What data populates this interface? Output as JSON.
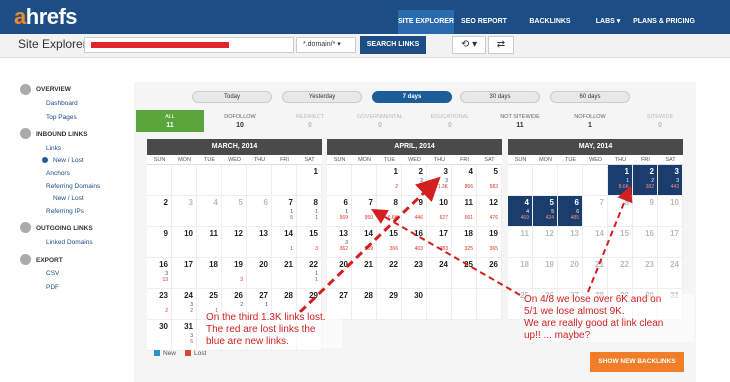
{
  "header": {
    "logo_a": "a",
    "logo_rest": "hrefs",
    "nav": [
      {
        "label": "SITE EXPLORER",
        "active": true
      },
      {
        "label": "SEO REPORT",
        "active": false
      },
      {
        "label": "BACKLINKS REPORT",
        "active": false
      },
      {
        "label": "LABS",
        "active": false
      },
      {
        "label": "PLANS & PRICING",
        "active": false
      }
    ]
  },
  "search": {
    "label": "Site Explorer:",
    "mode_value": "*.domain/*",
    "button_label": "SEARCH LINKS"
  },
  "sidebar": {
    "overview": "OVERVIEW",
    "dashboard": "Dashboard",
    "top_pages": "Top Pages",
    "inbound": "INBOUND LINKS",
    "links": "Links",
    "new_lost": "New / Lost",
    "anchors": "Anchors",
    "ref_domains": "Referring Domains",
    "ref_new_lost": "New / Lost",
    "ref_ips": "Referring IPs",
    "outgoing": "OUTGOING LINKS",
    "linked_domains": "Linked Domains",
    "export": "EXPORT",
    "csv": "CSV",
    "pdf": "PDF"
  },
  "periods": [
    "Today",
    "Yesterday",
    "7 days",
    "30 days",
    "60 days"
  ],
  "active_period": "7 days",
  "filters": [
    {
      "label": "ALL",
      "value": "11"
    },
    {
      "label": "DOFOLLOW",
      "value": "10"
    },
    {
      "label": "REDIRECT",
      "value": "0"
    },
    {
      "label": "GOVERNMENTAL",
      "value": "0"
    },
    {
      "label": "EDUCATIONAL",
      "value": "0"
    },
    {
      "label": "NOT SITEWIDE",
      "value": "11"
    },
    {
      "label": "NOFOLLOW",
      "value": "1"
    },
    {
      "label": "SITEWIDE",
      "value": "0"
    }
  ],
  "weekdays": [
    "SUN",
    "MON",
    "TUE",
    "WED",
    "THU",
    "FRI",
    "SAT"
  ],
  "calendars": [
    {
      "title": "MARCH, 2014",
      "start": 6,
      "days": 31,
      "grey_before": 0,
      "data": {
        "1": [
          "",
          ""
        ],
        "2": [
          "",
          ""
        ],
        "7": [
          "1",
          "5"
        ],
        "8": [
          "1",
          "1"
        ],
        "14": [
          "",
          "1"
        ],
        "15": [
          "",
          "3"
        ],
        "16": [
          "3",
          "13"
        ],
        "19": [
          "",
          "3"
        ],
        "22": [
          "1",
          "1"
        ],
        "23": [
          "",
          "2"
        ],
        "24": [
          "3",
          "2"
        ],
        "25": [
          "",
          "1"
        ],
        "26": [
          "2",
          ""
        ],
        "27": [
          "1",
          ""
        ],
        "28": [
          "",
          ""
        ],
        "29": [
          "",
          ""
        ],
        "31": [
          "3",
          "6"
        ],
        "30": [
          "",
          ""
        ]
      }
    },
    {
      "title": "APRIL, 2014",
      "start": 2,
      "days": 30,
      "data": {
        "1": [
          "",
          "2"
        ],
        "2": [
          "2",
          "41"
        ],
        "3": [
          "3",
          "1.3K"
        ],
        "4": [
          "",
          "866"
        ],
        "5": [
          "",
          "583"
        ],
        "6": [
          "1",
          "569"
        ],
        "7": [
          "",
          "950"
        ],
        "8": [
          "",
          "6.6K"
        ],
        "9": [
          "",
          "446"
        ],
        "10": [
          "",
          "627"
        ],
        "11": [
          "",
          "661"
        ],
        "12": [
          "",
          "476"
        ],
        "13": [
          "3",
          "362"
        ],
        "14": [
          "",
          "269"
        ],
        "15": [
          "",
          "366"
        ],
        "16": [
          "",
          "403"
        ],
        "17": [
          "",
          "383"
        ],
        "18": [
          "",
          "325"
        ],
        "19": [
          "",
          "365"
        ],
        "20": [
          "",
          ""
        ],
        "21": [
          "",
          ""
        ],
        "22": [
          "",
          ""
        ],
        "23": [
          "",
          ""
        ],
        "24": [
          "",
          ""
        ],
        "25": [
          "",
          ""
        ],
        "26": [
          "",
          ""
        ],
        "27": [
          "",
          ""
        ],
        "28": [
          "",
          ""
        ],
        "29": [
          "",
          ""
        ],
        "30": [
          "",
          ""
        ]
      }
    },
    {
      "title": "MAY, 2014",
      "start": 4,
      "days": 31,
      "data": {
        "1": [
          "1",
          "8.6K"
        ],
        "2": [
          "2",
          "382"
        ],
        "3": [
          "3",
          "443"
        ],
        "4": [
          "4",
          "469"
        ],
        "5": [
          "5",
          "424"
        ],
        "6": [
          "6",
          "485"
        ]
      }
    }
  ],
  "legend": {
    "new": "New",
    "lost": "Lost"
  },
  "colors": {
    "new": "#2a91c8",
    "lost": "#d8482a",
    "accent": "#1c4e85",
    "annotation": "#d31f1f"
  },
  "show_button": "SHOW NEW BACKLINKS",
  "annotations": {
    "left": [
      "On the third 1.3K links lost.",
      "The red are lost links the",
      "blue are new links."
    ],
    "right": [
      "On 4/8 we lose over 6K and on",
      "5/1 we lose almost 9K.",
      "We are really good at link clean",
      "up!! ... maybe?"
    ]
  }
}
